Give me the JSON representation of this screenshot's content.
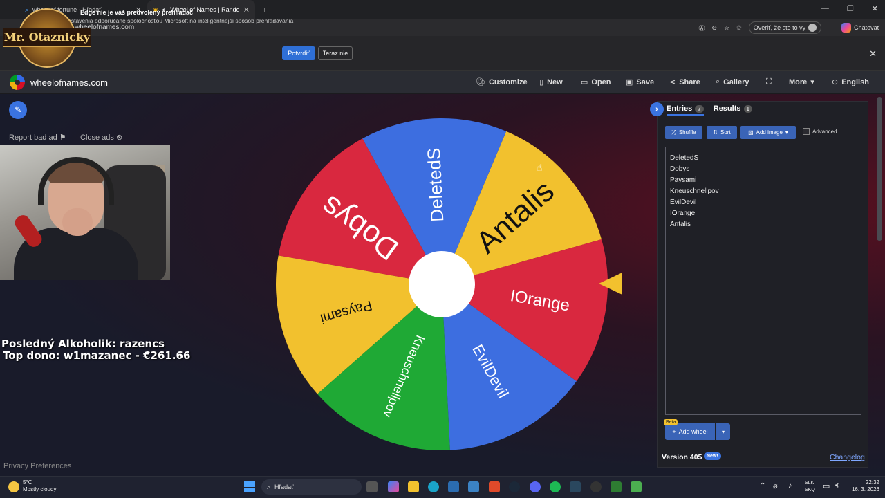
{
  "browser": {
    "tabs": [
      {
        "label": "wheel of fortune - Hľadať"
      },
      {
        "label": "Wheel of Names | Random na"
      }
    ],
    "url": "wheelofnames.com",
    "sign_in": "Overiť, že ste to vy",
    "copilot": "Chatovať"
  },
  "infobar": {
    "line1": "Edge nie je váš predvolený prehliadač",
    "line2": "Nastavenia odporúčané spoločnosťou Microsoft na inteligentnejší spôsob prehľadávania",
    "confirm": "Potvrdiť",
    "not_now": "Teraz nie"
  },
  "site": {
    "name": "wheelofnames.com",
    "nav": {
      "customize": "Customize",
      "new": "New",
      "open": "Open",
      "save": "Save",
      "share": "Share",
      "gallery": "Gallery",
      "more": "More",
      "language": "English"
    }
  },
  "ads": {
    "report_bad_ad": "Report bad ad",
    "close_ads": "Close ads"
  },
  "stream": {
    "logo_text": "Mr. Otaznicky",
    "last_alcoholic": "Posledný Alkoholik: razencs",
    "top_donor": "Top dono: w1mazanec - €261.66"
  },
  "wheel": {
    "segments": [
      {
        "name": "Antalis",
        "color": "#F2C12E"
      },
      {
        "name": "DeletedS",
        "color": "#3D6EE0"
      },
      {
        "name": "Dobys",
        "color": "#D9283F"
      },
      {
        "name": "Paysami",
        "color": "#F2C12E"
      },
      {
        "name": "Kneuschnellpov",
        "color": "#1FA935"
      },
      {
        "name": "EvilDevil",
        "color": "#3D6EE0"
      },
      {
        "name": "IOrange",
        "color": "#D9283F"
      }
    ]
  },
  "panel": {
    "tab_entries": "Entries",
    "entries_count": "7",
    "tab_results": "Results",
    "results_count": "1",
    "shuffle": "Shuffle",
    "sort": "Sort",
    "add_image": "Add image",
    "advanced": "Advanced",
    "entries": [
      "DeletedS",
      "Dobys",
      "Paysami",
      "Kneuschnellpov",
      "EvilDevil",
      "IOrange",
      "Antalis"
    ],
    "beta": "Beta",
    "add_wheel": "Add wheel",
    "version": "Version 405",
    "new_badge": "New!",
    "changelog": "Changelog"
  },
  "footer": {
    "privacy": "Privacy Preferences"
  },
  "taskbar": {
    "temp": "5°C",
    "weather": "Mostly cloudy",
    "search": "Hľadať",
    "lang1": "SLK",
    "lang2": "SKQ",
    "time": "22:32",
    "date": "16. 3. 2026"
  }
}
